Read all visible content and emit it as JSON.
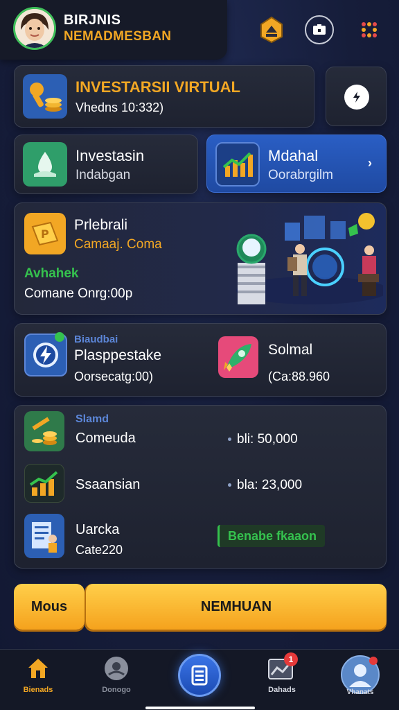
{
  "header": {
    "title": "BIRJNIS",
    "subtitle": "NEMADMESBAN"
  },
  "banner": {
    "title": "INVESTARSII VIRTUAL",
    "subtitle": "Vhedns 10:332)"
  },
  "tiles": [
    {
      "title": "Investasin",
      "subtitle": "Indabgan"
    },
    {
      "title": "Mdahal",
      "subtitle": "Oorabrgilm"
    }
  ],
  "feature": {
    "title": "Prlebrali",
    "subtitle": "Camaaj. Coma",
    "highlight": "Avhahek",
    "note": "Comane Onrg:00p"
  },
  "promo": {
    "left": {
      "tag": "Biaudbai",
      "title": "Plasppestake",
      "subtitle": "Oorsecatg:00)"
    },
    "right": {
      "title": "Solmal",
      "subtitle": "(Ca:88.960"
    }
  },
  "list": {
    "header": "Slamd",
    "items": [
      {
        "name": "Comeuda",
        "label": "bli:",
        "value": "50,000"
      },
      {
        "name": "Ssaansian",
        "label": "bla:",
        "value": "23,000"
      },
      {
        "name": "Uarcka",
        "sub": "Cate220",
        "badge": "Benabe fkaaon"
      }
    ]
  },
  "actions": {
    "secondary": "Mous",
    "primary": "NEMHUAN"
  },
  "nav": {
    "items": [
      {
        "label": "Bienads",
        "color": "#f2a724"
      },
      {
        "label": "Donogo",
        "color": "#8a8f9c"
      },
      {
        "label": "",
        "color": "#ffffff"
      },
      {
        "label": "Dahads",
        "color": "#d6d9e2"
      },
      {
        "label": "Vhanats",
        "color": "#d6d9e2"
      }
    ],
    "notif_count": "1"
  },
  "colors": {
    "accent": "#f2a724",
    "green": "#35c24e",
    "blue": "#2356b8",
    "background": "#161d3a"
  }
}
